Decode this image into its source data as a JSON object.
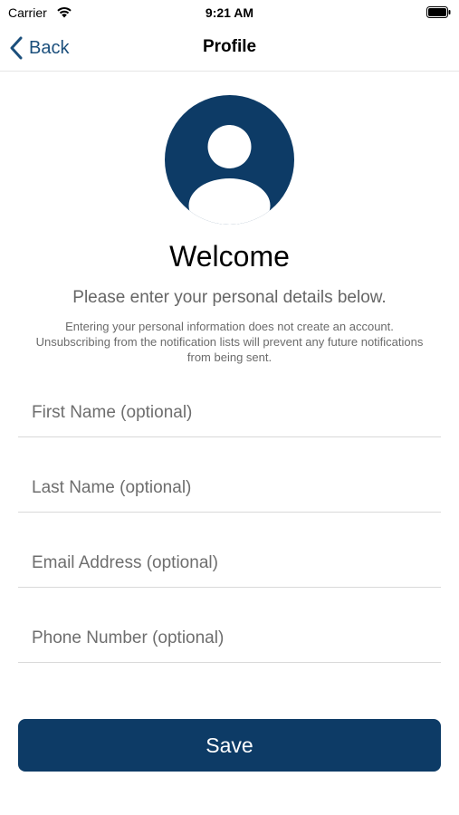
{
  "status_bar": {
    "carrier": "Carrier",
    "time": "9:21 AM",
    "icons": [
      "wifi-icon",
      "battery-icon"
    ]
  },
  "nav": {
    "back_label": "Back",
    "title": "Profile",
    "back_icon": "chevron-left-icon"
  },
  "avatar_icon": "person-icon",
  "header": {
    "welcome": "Welcome",
    "subtitle": "Please enter your personal details below.",
    "disclaimer": "Entering your personal information does not create an account. Unsubscribing from the notification lists will prevent any future notifications from being sent."
  },
  "form": {
    "first_name": {
      "placeholder": "First Name (optional)",
      "value": ""
    },
    "last_name": {
      "placeholder": "Last Name (optional)",
      "value": ""
    },
    "email": {
      "placeholder": "Email Address (optional)",
      "value": ""
    },
    "phone": {
      "placeholder": "Phone Number (optional)",
      "value": ""
    }
  },
  "save_label": "Save",
  "colors": {
    "accent": "#0d3b66",
    "link": "#1b4f7c",
    "background": "#ffffff"
  }
}
